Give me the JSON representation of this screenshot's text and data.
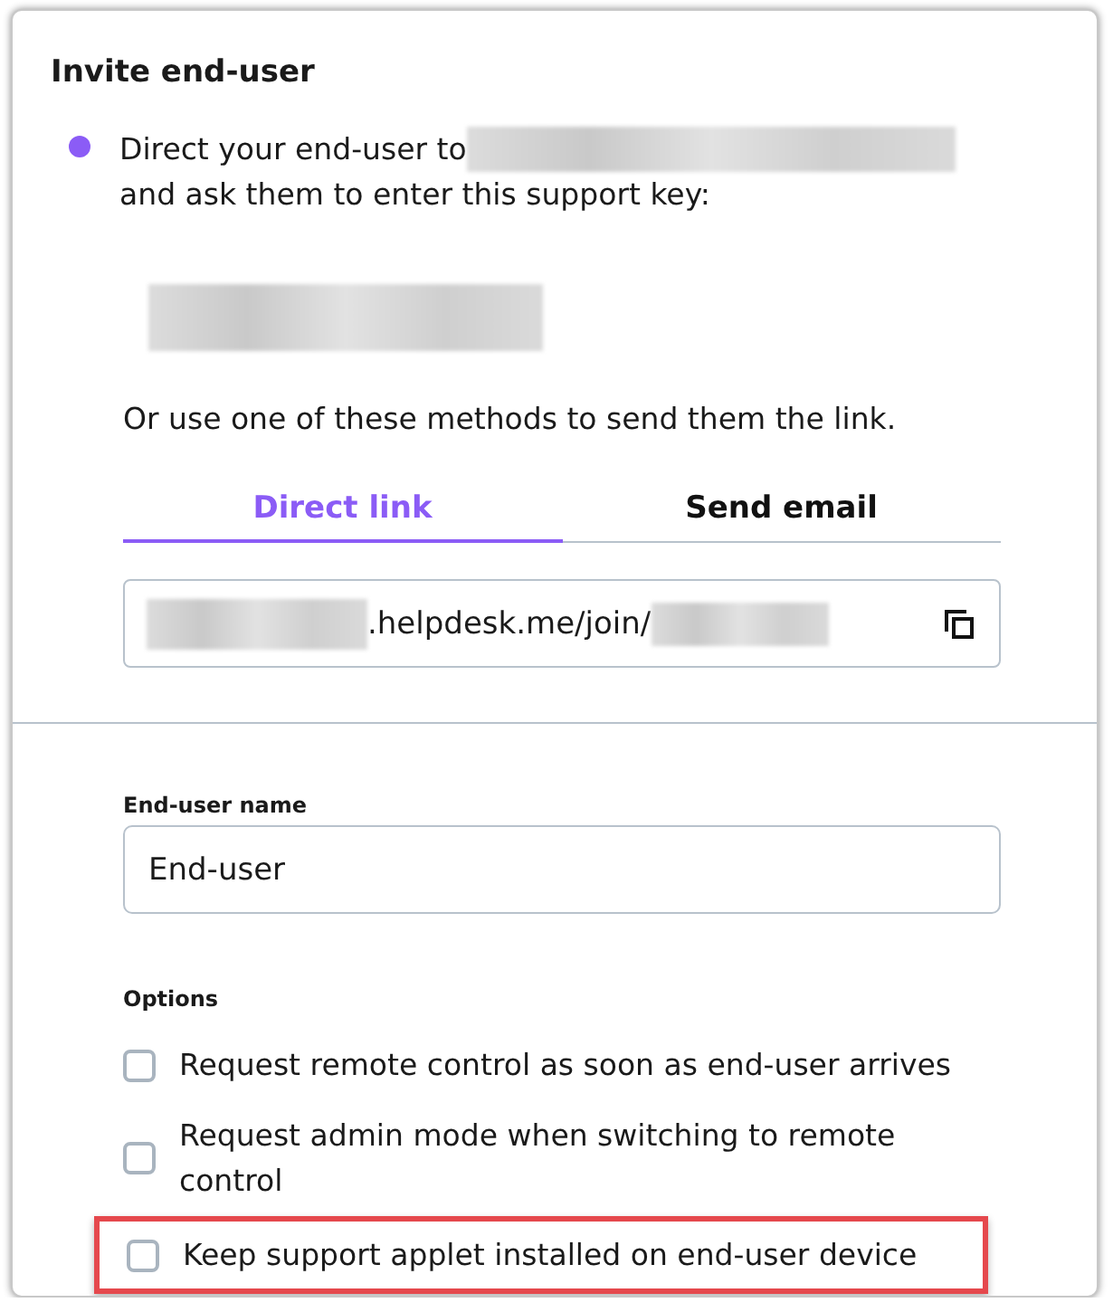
{
  "dialog": {
    "title": "Invite end-user"
  },
  "instruction": {
    "line_1": "Direct your end-user to",
    "line_2": "and ask them to enter this support key:"
  },
  "methods_hint": "Or use one of these methods to send them the link.",
  "tabs": [
    {
      "label": "Direct link",
      "selected": true
    },
    {
      "label": "Send email",
      "selected": false
    }
  ],
  "link_field": {
    "value": ".helpdesk.me/join/"
  },
  "name_field": {
    "label": "End-user name",
    "value": "End-user"
  },
  "options": {
    "heading": "Options",
    "items": [
      {
        "label": "Request remote control as soon as end-user arrives",
        "checked": false,
        "highlighted": false
      },
      {
        "label": "Request admin mode when switching to remote control",
        "checked": false,
        "highlighted": false
      },
      {
        "label": "Keep support applet installed on end-user device",
        "checked": false,
        "highlighted": true
      }
    ]
  }
}
